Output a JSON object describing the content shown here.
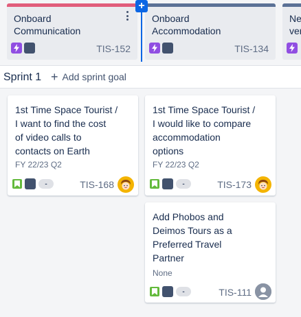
{
  "epics": [
    {
      "line1": "Onboard",
      "line2": "Communication",
      "key": "TIS-152",
      "bar_color": "#e15d7b"
    },
    {
      "line1": "Onboard",
      "line2": "Accommodation",
      "key": "TIS-134",
      "bar_color": "#5b7196"
    },
    {
      "line1": "Ne",
      "line2": "ver",
      "key": "",
      "bar_color": "#5b7196"
    }
  ],
  "sprint": {
    "name": "Sprint 1",
    "add_goal": "Add sprint goal"
  },
  "cards": [
    {
      "lines": [
        "1st Time Space Tourist /",
        "I want to find the cost",
        "of video calls to",
        "contacts on Earth"
      ],
      "fix_version": "FY 22/23 Q2",
      "key": "TIS-168",
      "estimate": "-",
      "assignee": "face-avatar"
    },
    {
      "lines": [
        "1st Time Space Tourist /",
        "I would like to compare",
        "accommodation",
        "options"
      ],
      "fix_version": "FY 22/23 Q2",
      "key": "TIS-173",
      "estimate": "-",
      "assignee": "face-avatar"
    },
    {
      "lines": [
        "Add Phobos and",
        "Deimos Tours as a",
        "Preferred Travel",
        "Partner"
      ],
      "fix_version": "None",
      "key": "TIS-111",
      "estimate": "-",
      "assignee": "unassigned-avatar"
    }
  ],
  "colors": {
    "accent": "#0c66e4",
    "epic_icon": "#904ee2",
    "story_icon": "#63ba3c"
  }
}
